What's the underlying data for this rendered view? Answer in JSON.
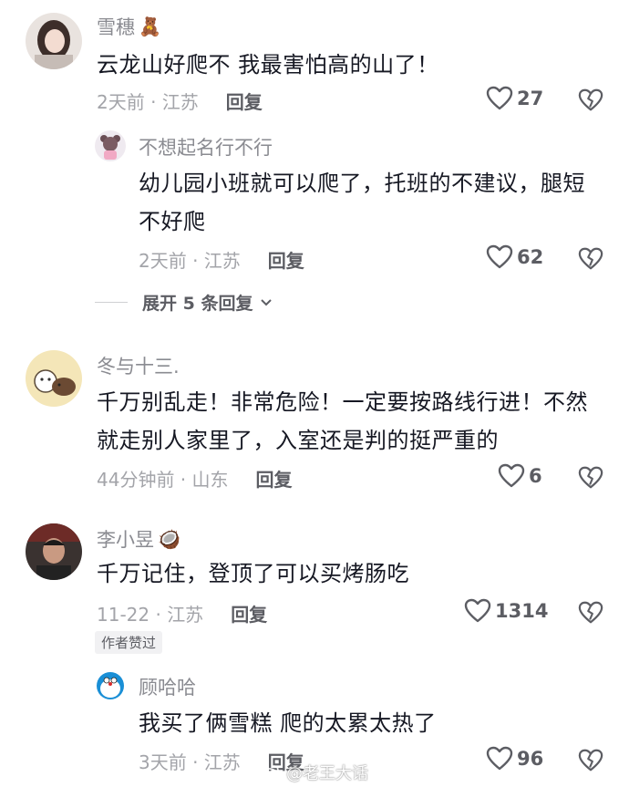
{
  "comments": [
    {
      "username": "雪穗",
      "badge": "🧸",
      "text": "云龙山好爬不 我最害怕高的山了！",
      "time": "2天前 · 江苏",
      "reply_label": "回复",
      "likes": "27",
      "avatar_icon": "girl-photo-avatar"
    },
    {
      "username": "不想起名行不行",
      "text_lines": [
        "幼儿园小班就可以爬了，托班的不建议，腿短",
        "不好爬"
      ],
      "time": "2天前 · 江苏",
      "reply_label": "回复",
      "likes": "62",
      "avatar_icon": "cartoon-bear-avatar"
    },
    {
      "username": "冬与十三.",
      "text_lines": [
        "千万别乱走！非常危险！一定要按路线行进！不然",
        "就走别人家里了，入室还是判的挺严重的"
      ],
      "time": "44分钟前 · 山东",
      "reply_label": "回复",
      "likes": "6",
      "avatar_icon": "cartoon-dog-avatar"
    },
    {
      "username": "李小昱",
      "badge": "🥥",
      "text": "千万记住，登顶了可以买烤肠吃",
      "time": "11-22 · 江苏",
      "reply_label": "回复",
      "likes": "1314",
      "author_tag": "作者赞过",
      "avatar_icon": "man-photo-avatar"
    },
    {
      "username": "顾哈哈",
      "text": "我买了俩雪糕  爬的太累太热了",
      "time": "3天前 · 江苏",
      "reply_label": "回复",
      "likes": "96",
      "avatar_icon": "doraemon-avatar"
    }
  ],
  "expand_replies": "展开 5 条回复",
  "watermark": "@老王大话",
  "colors": {
    "text": "#161823",
    "meta": "#a3a4a9",
    "username": "#8a8b91"
  }
}
